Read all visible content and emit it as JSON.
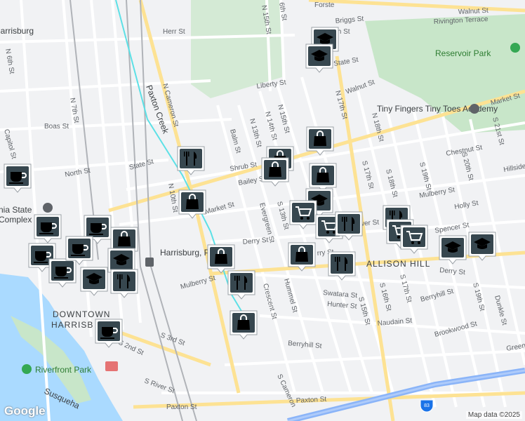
{
  "map": {
    "logo": "Google",
    "attribution": "Map data ©2025",
    "city_label": "Harrisburg",
    "area_labels": {
      "downtown_1": "DOWNTOWN",
      "downtown_2": "HARRISB",
      "allison_hill": "ALLISON HILL"
    },
    "places": {
      "reservoir_park": "Reservoir Park",
      "tiny_fingers": "Tiny Fingers Tiny Toes Academy",
      "riverfront_park": "Riverfront Park",
      "state_complex_1": "nia State",
      "state_complex_2": "Complex",
      "harrisburg_station": "Harrisburg, Penns",
      "paxton_creek": "Paxton Creek",
      "susquehanna": "Susqueha"
    },
    "streets": {
      "walnut_st_ne": "Walnut St",
      "rivington": "Rivington Terrace",
      "forster": "Forste",
      "briggs": "Briggs St",
      "herr": "Herr St",
      "n15th_top": "N 15th St",
      "n16th_top": "6th St",
      "n6th": "N 6th St",
      "n7th": "N 7th St",
      "n_cameron": "N Cameron St",
      "liberty": "Liberty St",
      "walnut_mid": "Walnut St",
      "n17th": "N 17th St",
      "boas": "Boas St",
      "capitol": "Capitol St",
      "n10th": "N 10th St",
      "balm": "Balm St",
      "n13th": "N 13th St",
      "n14th": "N 14th St",
      "n15th": "N 15th St",
      "n18th": "N 18th St",
      "s17th_n": "S 17th St",
      "s18th_n": "S 18th St",
      "s19th": "S 19th St",
      "s20th": "S 20th St",
      "s21st": "S 21st St",
      "market_w": "Market St",
      "market_e": "Market St",
      "chestnut": "Chestnut St",
      "hillside": "Hillside",
      "state_w": "State St",
      "north": "North St",
      "shrub": "Shrub St",
      "bailey": "Bailey St",
      "mulberry_e": "Mulberry St",
      "evergreen": "Evergreen St",
      "s13th": "S 13th St",
      "holly": "Holly St",
      "spencer": "Spencer St",
      "derry_w": "Derry St",
      "derry_mid": "rry St",
      "derry_e": "Derry St",
      "mulberry_w": "Mulberry St",
      "crescent": "Crescent St",
      "hummel": "Hummel St",
      "swatara": "Swatara St",
      "hunter": "Hunter St",
      "s15th": "S 15th St",
      "s16th": "S 16th St",
      "s17th": "S 17th St",
      "naudain": "Naudain St",
      "s19th_s": "S 19th St",
      "dunkle": "Dunkle St",
      "berryhill_e": "Berryhill St",
      "brookwood": "Brookwood St",
      "berryhill_w": "Berryhill St",
      "s3rd": "S 3rd St",
      "s2nd": "S 2nd St",
      "s_river": "S River St",
      "s_cameron": "S Cameron",
      "paxton_w": "Paxton St",
      "paxton_e": "Paxton St",
      "greenwood": "Greenw",
      "mkt_st_ne": "Market St",
      "n6th_top": "6th St",
      "state_st_ne": "State St",
      "xth_st": "th St",
      "wer_st": "wer St"
    },
    "colors": {
      "background": "#f1f2f4",
      "water": "#aadaff",
      "park": "#c8e6c9",
      "road": "#ffffff",
      "arterial": "#fde293",
      "highway": "#8ab4f8",
      "rail": "#b0b3b8",
      "creek": "#5ce0e6",
      "marker": "#37474f"
    },
    "marker_types": [
      "coffee-icon",
      "education-icon",
      "shopping-bag-icon",
      "restaurant-icon",
      "grocery-cart-icon"
    ]
  }
}
